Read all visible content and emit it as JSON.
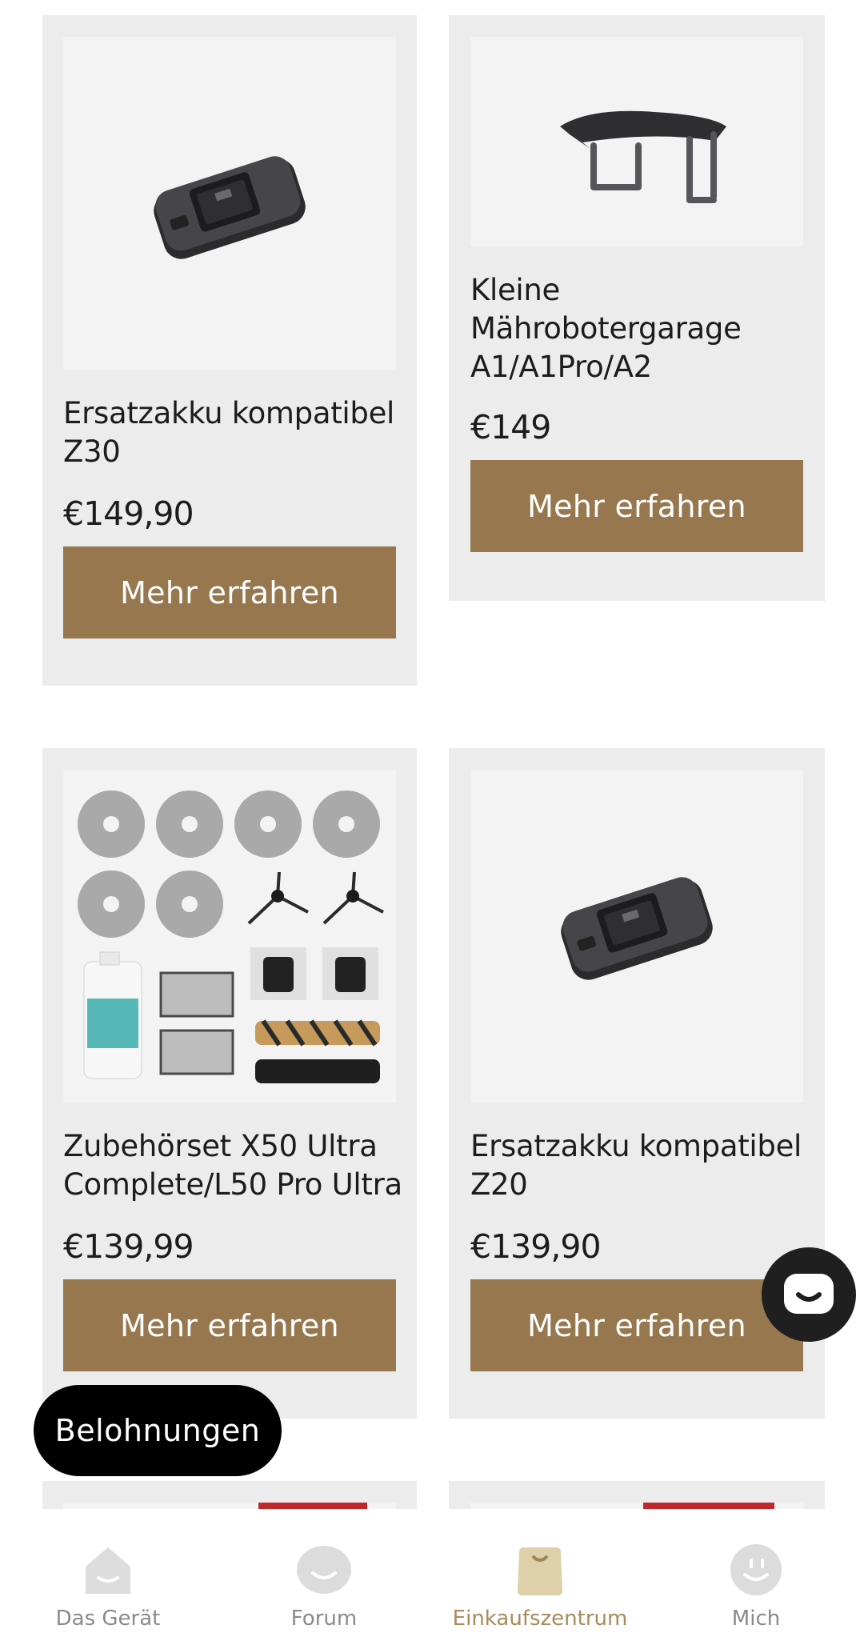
{
  "products": [
    {
      "title_line1": "Ersatzakku kompatibel",
      "title_line2": "Z30",
      "title_line3": "",
      "price": "€149,90",
      "button": "Mehr erfahren",
      "image_icon": "battery-pack-icon"
    },
    {
      "title_line1": "Kleine",
      "title_line2": "Mährobotergarage",
      "title_line3": "A1/A1Pro/A2",
      "price": "€149",
      "button": "Mehr erfahren",
      "image_icon": "robot-garage-icon"
    },
    {
      "title_line1": "Zubehörset X50 Ultra",
      "title_line2": "Complete/L50 Pro Ultra",
      "title_line3": "",
      "price": "€139,99",
      "button": "Mehr erfahren",
      "image_icon": "accessory-kit-icon"
    },
    {
      "title_line1": "Ersatzakku kompatibel",
      "title_line2": "Z20",
      "title_line3": "",
      "price": "€139,90",
      "button": "Mehr erfahren",
      "image_icon": "battery-pack-icon"
    }
  ],
  "rewards_button": "Belohnungen",
  "chat_button_icon": "chat-bubble-icon",
  "tabbar": {
    "items": [
      {
        "label": "Das Gerät",
        "icon": "home-icon"
      },
      {
        "label": "Forum",
        "icon": "forum-icon"
      },
      {
        "label": "Einkaufszentrum",
        "icon": "shopping-bag-icon"
      },
      {
        "label": "Mich",
        "icon": "profile-icon"
      }
    ],
    "active_index": 2
  },
  "colors": {
    "button": "#96774e",
    "active_tab": "#a88a5a",
    "card_bg": "#ececec",
    "sale_tag": "#c0282b"
  }
}
